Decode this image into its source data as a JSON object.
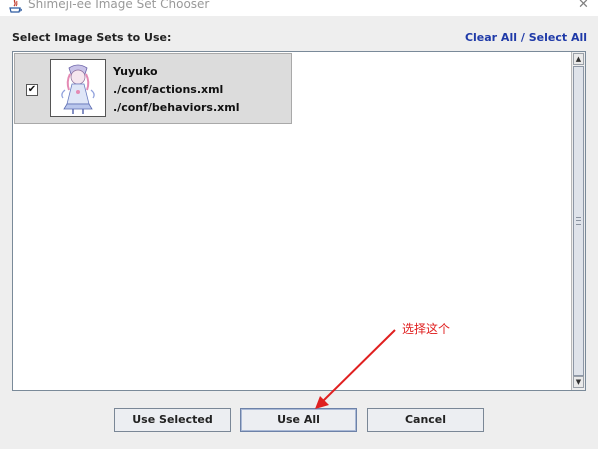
{
  "window": {
    "title": "Shimeji-ee Image Set Chooser",
    "close_label": "✕"
  },
  "header": {
    "label": "Select Image Sets to Use:",
    "clear_all": "Clear All",
    "separator": "/",
    "select_all": "Select All"
  },
  "list": {
    "items": [
      {
        "checked": true,
        "check_mark": "✔",
        "name": "Yuyuko",
        "actions": "./conf/actions.xml",
        "behaviors": "./conf/behaviors.xml"
      }
    ],
    "scroll_up": "▲",
    "scroll_down": "▼"
  },
  "buttons": {
    "use_selected": "Use Selected",
    "use_all": "Use All",
    "cancel": "Cancel"
  },
  "annotation": {
    "text": "选择这个",
    "color": "#e02020"
  },
  "colors": {
    "link": "#1f3aa8",
    "item_background": "#dcdcdc"
  }
}
